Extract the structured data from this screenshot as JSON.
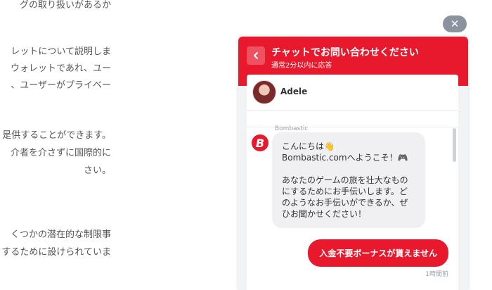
{
  "article": {
    "lines": [
      "グの取り扱いがあるか",
      "レットについて説明しま",
      "ウォレットであれ、ユー",
      "、ユーザーがプライベー",
      "是供することができます。",
      "介者を介さずに国際的に",
      "さい。",
      "くつかの潜在的な制限事",
      "するために設けられていま"
    ]
  },
  "close_button": {
    "label": "✕"
  },
  "chat": {
    "header_title": "チャットでお問い合わせください",
    "header_subtitle": "通常2分以内に応答",
    "agent_name": "Adele",
    "sender_label": "Bombastic",
    "bot_message_line1": "こんにちは👋",
    "bot_message_line2": "Bombastic.comへようこそ！🎮",
    "bot_message_line3": "あなたのゲームの旅を壮大なものにするためにお手伝いします。どのようなお手伝いができるか、ぜひお聞かせください！",
    "user_message": "入金不要ボーナスが貰えません",
    "timestamp": "1時間前",
    "accent_color": "#e8192c",
    "icons": {
      "back": "chevron-left-icon",
      "close": "close-icon",
      "bot": "bombastic-logo-icon"
    }
  }
}
